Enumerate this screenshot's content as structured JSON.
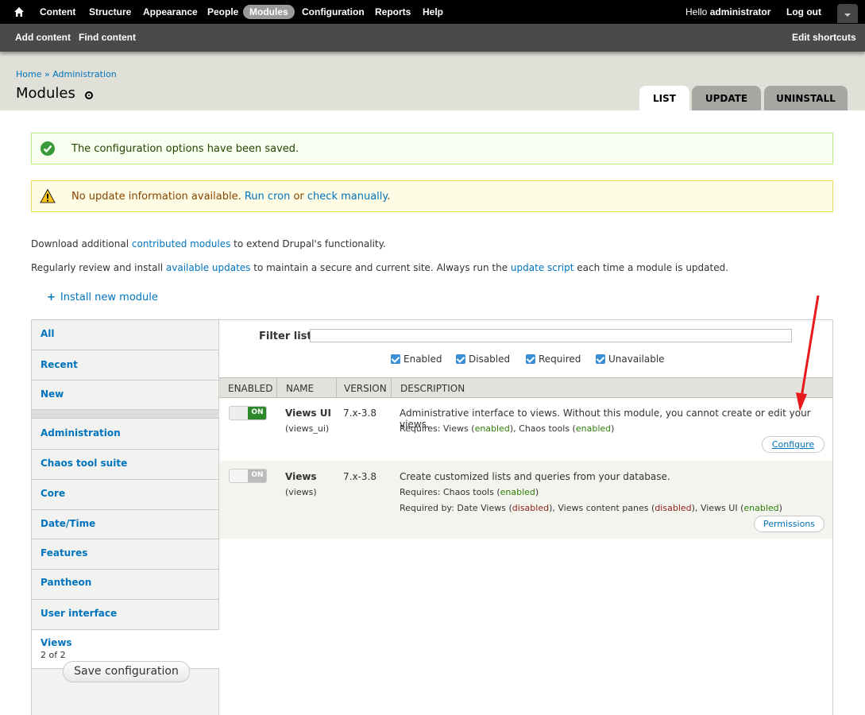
{
  "toolbar": {
    "menu": [
      "Content",
      "Structure",
      "Appearance",
      "People",
      "Modules",
      "Configuration",
      "Reports",
      "Help"
    ],
    "active": "Modules",
    "greeting_prefix": "Hello ",
    "user": "administrator",
    "logout": "Log out"
  },
  "shortcuts": {
    "items": [
      "Add content",
      "Find content"
    ],
    "edit": "Edit shortcuts"
  },
  "breadcrumb": {
    "home": "Home",
    "sep": " » ",
    "admin": "Administration"
  },
  "page": {
    "title": "Modules"
  },
  "tabs": [
    "LIST",
    "UPDATE",
    "UNINSTALL"
  ],
  "messages": {
    "status": "The configuration options have been saved.",
    "warning_pre": "No update information available. ",
    "run_cron": "Run cron",
    "or": " or ",
    "check_manually": "check manually",
    "period": "."
  },
  "help": {
    "line1_pre": "Download additional ",
    "line1_link": "contributed modules",
    "line1_post": " to extend Drupal's functionality.",
    "line2_pre": "Regularly review and install ",
    "line2_link1": "available updates",
    "line2_mid": " to maintain a secure and current site. Always run the ",
    "line2_link2": "update script",
    "line2_post": " each time a module is updated."
  },
  "install_link": {
    "plus": "+",
    "label": "Install new module"
  },
  "vertical_tabs": {
    "items": [
      "All",
      "Recent",
      "New",
      "Administration",
      "Chaos tool suite",
      "Core",
      "Date/Time",
      "Features",
      "Pantheon",
      "User interface"
    ],
    "selected_label": "Views",
    "selected_summary": "2 of 2",
    "save": "Save configuration"
  },
  "filter": {
    "label": "Filter list",
    "value": "",
    "checkboxes": [
      "Enabled",
      "Disabled",
      "Required",
      "Unavailable"
    ]
  },
  "table": {
    "headers": [
      "ENABLED",
      "NAME",
      "VERSION",
      "DESCRIPTION"
    ],
    "rows": [
      {
        "toggle": "ON",
        "enabled": true,
        "name": "Views UI",
        "machine": "(views_ui)",
        "version": "7.x-3.8",
        "description": "Administrative interface to views. Without this module, you cannot create or edit your views.",
        "requires_label": "Requires: ",
        "requires": [
          {
            "name": "Views",
            "status": "enabled"
          },
          {
            "name": "Chaos tools",
            "status": "enabled"
          }
        ],
        "operation": "Configure"
      },
      {
        "toggle": "ON",
        "enabled": false,
        "name": "Views",
        "machine": "(views)",
        "version": "7.x-3.8",
        "description": "Create customized lists and queries from your database.",
        "requires_label": "Requires: ",
        "requires": [
          {
            "name": "Chaos tools",
            "status": "enabled"
          }
        ],
        "required_by_label": "Required by: ",
        "required_by": [
          {
            "name": "Date Views",
            "status": "disabled"
          },
          {
            "name": "Views content panes",
            "status": "disabled"
          },
          {
            "name": "Views UI",
            "status": "enabled"
          }
        ],
        "operation": "Permissions"
      }
    ]
  },
  "colors": {
    "link": "#0074bd",
    "toolbar": "#000000",
    "shortcut_bar": "#4a4a4a",
    "enabled": "#2e7d06",
    "disabled": "#8a1f11",
    "annotation_arrow": "#e8191c"
  }
}
